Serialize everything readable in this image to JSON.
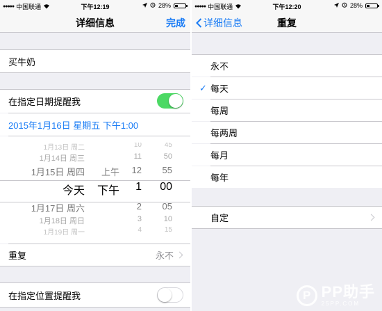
{
  "left": {
    "status": {
      "carrier": "中国联通",
      "time": "下午12:19",
      "battery": "28%"
    },
    "nav": {
      "title": "详细信息",
      "done": "完成"
    },
    "task_title": "买牛奶",
    "remind_on_date": {
      "label": "在指定日期提醒我",
      "on": true
    },
    "date_value": "2015年1月16日 星期五 下午1:00",
    "picker": {
      "dates": [
        "1月13日 周二",
        "1月14日 周三",
        "1月15日 周四",
        "今天",
        "1月17日 周六",
        "1月18日 周日",
        "1月19日 周一"
      ],
      "ampm_above": "上午",
      "ampm_selected": "下午",
      "hours": [
        "10",
        "11",
        "12",
        "1",
        "2",
        "3",
        "4"
      ],
      "minutes": [
        "45",
        "50",
        "55",
        "00",
        "05",
        "10",
        "15"
      ]
    },
    "repeat": {
      "label": "重复",
      "value": "永不"
    },
    "remind_on_location": {
      "label": "在指定位置提醒我",
      "on": false
    }
  },
  "right": {
    "status": {
      "carrier": "中国联通",
      "time": "下午12:20",
      "battery": "28%"
    },
    "nav": {
      "back": "详细信息",
      "title": "重复"
    },
    "options": [
      "永不",
      "每天",
      "每周",
      "每两周",
      "每月",
      "每年"
    ],
    "selected_index": 1,
    "custom": "自定"
  },
  "watermark": {
    "logo": "P",
    "text": "PP助手",
    "sub": "25PP.COM"
  },
  "colors": {
    "accent": "#1a7cf5",
    "toggle_on": "#4cd964",
    "background": "#efeff4"
  }
}
